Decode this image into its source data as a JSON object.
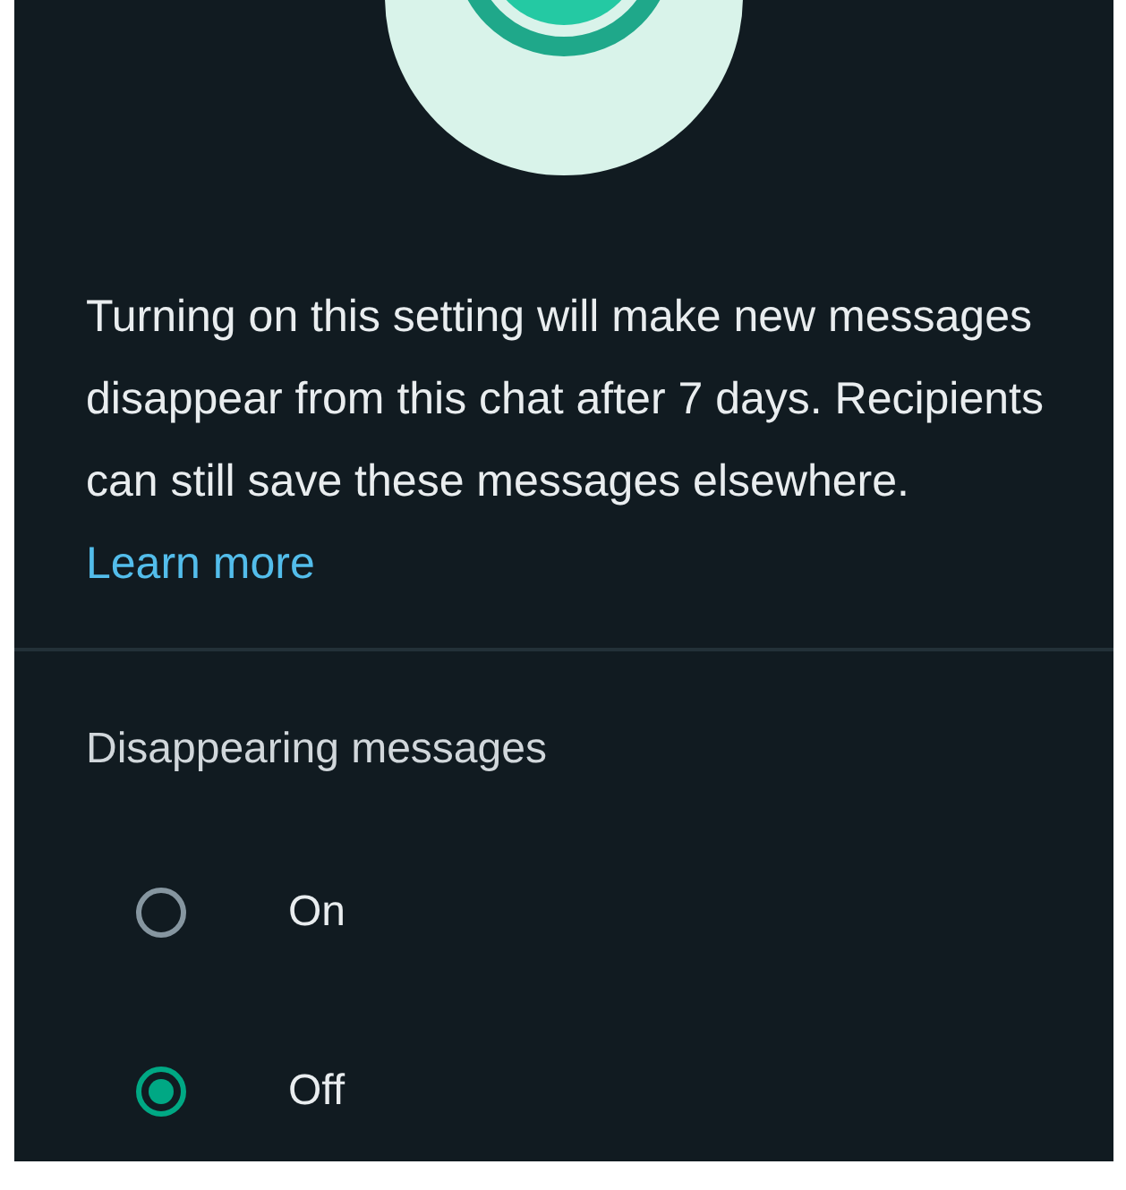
{
  "description": {
    "text": "Turning on this setting will make new messages disappear from this chat after 7 days. Recipients can still save these messages elsewhere.",
    "link": "Learn more"
  },
  "section_title": "Disappearing messages",
  "options": [
    {
      "label": "On",
      "selected": false
    },
    {
      "label": "Off",
      "selected": true
    }
  ]
}
